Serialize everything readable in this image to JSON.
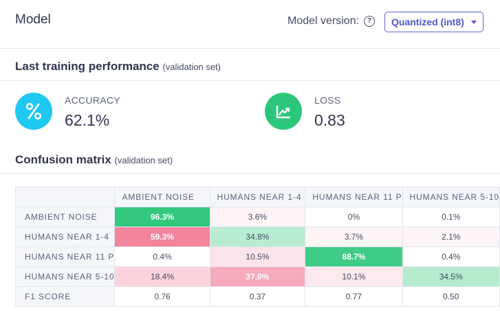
{
  "header": {
    "title": "Model",
    "model_version_label": "Model version:",
    "help_icon": "question-circle-icon",
    "model_version_value": "Quantized (int8)"
  },
  "performance": {
    "heading": "Last training performance",
    "subheading": "(validation set)",
    "accuracy": {
      "label": "ACCURACY",
      "value": "62.1%",
      "icon": "percent-icon",
      "color": "#1ec8f0"
    },
    "loss": {
      "label": "LOSS",
      "value": "0.83",
      "icon": "trending-chart-icon",
      "color": "#2cc67a"
    }
  },
  "confusion": {
    "heading": "Confusion matrix",
    "subheading": "(validation set)",
    "columns": [
      "AMBIENT NOISE",
      "HUMANS NEAR 1-4",
      "HUMANS NEAR 11 P",
      "HUMANS NEAR 5-10"
    ],
    "rows": [
      {
        "label": "AMBIENT NOISE",
        "cells": [
          "96.3%",
          "3.6%",
          "0%",
          "0.1%"
        ]
      },
      {
        "label": "HUMANS NEAR 1-4",
        "cells": [
          "59.3%",
          "34.8%",
          "3.7%",
          "2.1%"
        ]
      },
      {
        "label": "HUMANS NEAR 11 P",
        "cells": [
          "0.4%",
          "10.5%",
          "88.7%",
          "0.4%"
        ]
      },
      {
        "label": "HUMANS NEAR 5-10",
        "cells": [
          "18.4%",
          "37.0%",
          "10.1%",
          "34.5%"
        ]
      },
      {
        "label": "F1 SCORE",
        "cells": [
          "0.76",
          "0.37",
          "0.77",
          "0.50"
        ]
      }
    ],
    "cell_colors": [
      [
        "#33c87e",
        "#fdf4f6",
        "#ffffff",
        "#ffffff"
      ],
      [
        "#f2849c",
        "#b8ecd0",
        "#fdf4f6",
        "#fdf4f6"
      ],
      [
        "#ffffff",
        "#fde4ea",
        "#40cb86",
        "#ffffff"
      ],
      [
        "#fbd3dd",
        "#f6aabb",
        "#fde9ee",
        "#b5ecce"
      ],
      [
        "#ffffff",
        "#ffffff",
        "#ffffff",
        "#ffffff"
      ]
    ],
    "strong_cells": [
      [
        0,
        0
      ],
      [
        1,
        0
      ],
      [
        2,
        2
      ],
      [
        3,
        1
      ]
    ]
  }
}
